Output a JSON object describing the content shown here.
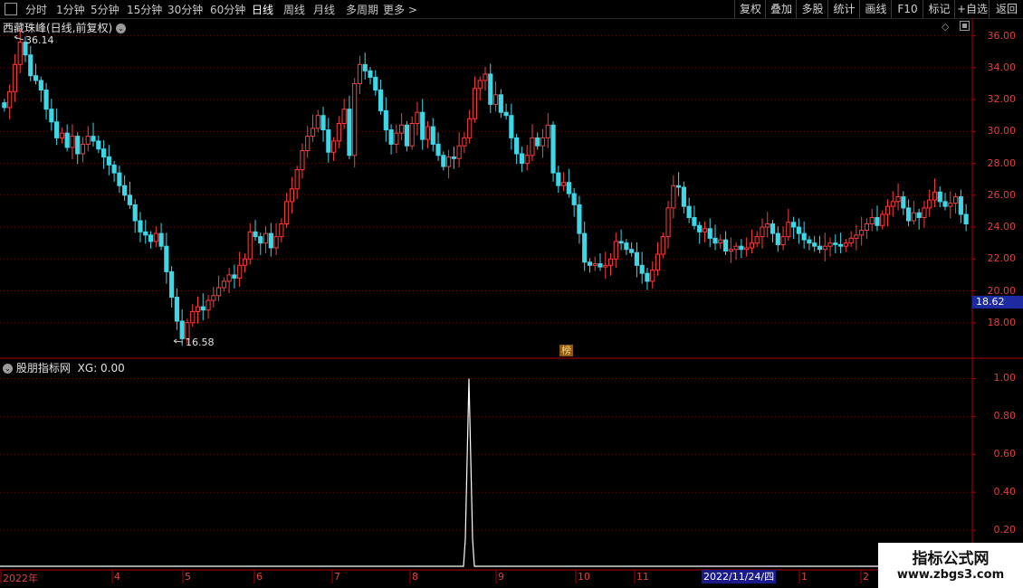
{
  "toolbar": {
    "left_items": [
      "分时",
      "1分钟",
      "5分钟",
      "15分钟",
      "30分钟",
      "60分钟",
      "日线",
      "周线",
      "月线",
      "多周期",
      "更多 >"
    ],
    "active_item": "日线",
    "right_items": [
      "复权",
      "叠加",
      "多股",
      "统计",
      "画线",
      "F10",
      "标记",
      "+自选",
      "返回"
    ]
  },
  "main_pane": {
    "title": "西藏珠峰(日线,前复权)",
    "high_marker": "36.14",
    "low_marker": "16.58",
    "current_price_tag": "18.62",
    "badge": "榜",
    "y_axis_labels": [
      "36.00",
      "34.00",
      "32.00",
      "30.00",
      "28.00",
      "26.00",
      "24.00",
      "22.00",
      "20.00",
      "18.00"
    ]
  },
  "indicator_pane": {
    "title": "股朋指标网",
    "value_text": "XG: 0.00",
    "y_axis_labels": [
      "1.00",
      "0.80",
      "0.60",
      "0.40",
      "0.20"
    ]
  },
  "x_axis": {
    "labels": [
      "2022年",
      "4",
      "5",
      "6",
      "7",
      "8",
      "9",
      "10",
      "11",
      "1",
      "2"
    ],
    "cursor_date": "2022/11/24/四"
  },
  "watermark": {
    "line1": "指标公式网",
    "line2": "www.zbgs3.com"
  },
  "colors": {
    "up": "#ff3c3c",
    "down": "#3cd8e8",
    "axis": "#b00000",
    "grid": "#6a0000",
    "indicator_line": "#ffffff"
  },
  "chart_data": [
    {
      "type": "candlestick",
      "title": "西藏珠峰(日线,前复权)",
      "ylim": [
        16,
        37
      ],
      "y_ticks": [
        18,
        20,
        22,
        24,
        26,
        28,
        30,
        32,
        34,
        36
      ],
      "close": [
        31.5,
        32.5,
        34.2,
        35.6,
        34.8,
        33.5,
        33.2,
        32.6,
        31.4,
        30.6,
        29.6,
        29.9,
        29.0,
        29.7,
        28.6,
        29.2,
        29.7,
        29.4,
        28.9,
        28.4,
        27.9,
        27.4,
        26.6,
        26.0,
        25.4,
        24.4,
        23.7,
        23.5,
        23.1,
        23.6,
        22.8,
        21.2,
        19.6,
        18.1,
        17.0,
        18.0,
        18.7,
        19.0,
        18.8,
        19.4,
        19.7,
        20.2,
        20.6,
        21.0,
        20.8,
        21.6,
        22.0,
        23.7,
        23.4,
        23.0,
        23.6,
        22.7,
        23.4,
        24.2,
        25.6,
        26.4,
        27.6,
        28.8,
        29.7,
        30.2,
        31.0,
        30.1,
        28.7,
        29.4,
        30.5,
        31.4,
        28.5,
        33.0,
        34.2,
        33.8,
        33.4,
        32.6,
        31.3,
        30.1,
        29.2,
        29.9,
        30.4,
        29.1,
        30.5,
        31.2,
        29.5,
        30.3,
        29.2,
        28.5,
        27.8,
        28.4,
        28.3,
        29.1,
        29.6,
        30.8,
        32.7,
        33.2,
        33.6,
        31.7,
        32.3,
        31.2,
        31.0,
        29.6,
        28.6,
        28.0,
        28.5,
        29.6,
        29.1,
        29.6,
        30.4,
        27.4,
        26.6,
        26.8,
        26.1,
        25.4,
        23.6,
        21.8,
        21.6,
        21.7,
        21.5,
        21.6,
        22.0,
        23.1,
        23.0,
        22.6,
        22.4,
        21.6,
        21.1,
        20.6,
        21.3,
        22.3,
        23.4,
        25.2,
        26.6,
        26.5,
        25.3,
        24.6,
        24.1,
        23.7,
        23.9,
        23.3,
        23.0,
        23.2,
        22.5,
        22.6,
        22.8,
        22.6,
        22.7,
        23.0,
        23.4,
        24.0,
        24.2,
        23.6,
        22.9,
        23.4,
        24.3,
        24.0,
        23.6,
        23.2,
        23.0,
        22.8,
        22.6,
        22.8,
        23.0,
        22.9,
        22.8,
        23.0,
        23.3,
        23.5,
        23.8,
        24.2,
        24.6,
        24.1,
        24.8,
        25.3,
        25.6,
        25.9,
        25.2,
        24.4,
        24.9,
        24.6,
        25.2,
        25.7,
        26.2,
        25.6,
        25.3,
        25.5,
        25.9,
        24.8,
        24.2
      ]
    },
    {
      "type": "line",
      "series": [
        {
          "name": "XG",
          "peak_value": 1.0
        }
      ],
      "ylim": [
        0,
        1.05
      ],
      "y_ticks": [
        0.2,
        0.4,
        0.6,
        0.8,
        1.0
      ]
    }
  ]
}
